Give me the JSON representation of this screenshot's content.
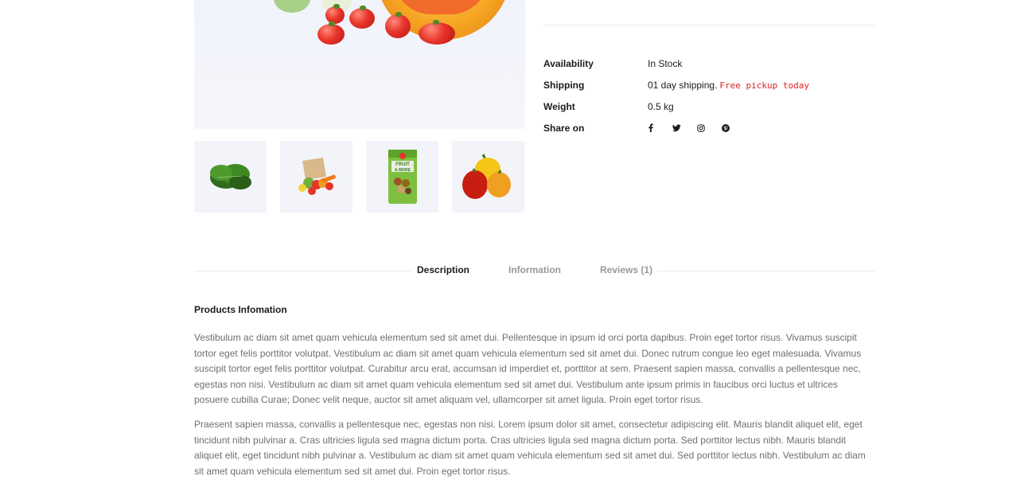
{
  "details": {
    "availability_label": "Availability",
    "availability_value": "In Stock",
    "shipping_label": "Shipping",
    "shipping_value": "01 day shipping.",
    "shipping_note": "Free pickup today",
    "weight_label": "Weight",
    "weight_value": "0.5 kg",
    "share_label": "Share on",
    "share_icons": [
      "facebook-icon",
      "twitter-icon",
      "instagram-icon",
      "pinterest-icon"
    ]
  },
  "thumbnails": [
    "spinach",
    "grocery-bag",
    "fruit-and-more-pack",
    "bell-peppers"
  ],
  "tabs": {
    "description": "Description",
    "information": "Information",
    "reviews": "Reviews (1)"
  },
  "description": {
    "title": "Products Infomation",
    "paragraph1": "Vestibulum ac diam sit amet quam vehicula elementum sed sit amet dui. Pellentesque in ipsum id orci porta dapibus. Proin eget tortor risus. Vivamus suscipit tortor eget felis porttitor volutpat. Vestibulum ac diam sit amet quam vehicula elementum sed sit amet dui. Donec rutrum congue leo eget malesuada. Vivamus suscipit tortor eget felis porttitor volutpat. Curabitur arcu erat, accumsan id imperdiet et, porttitor at sem. Praesent sapien massa, convallis a pellentesque nec, egestas non nisi. Vestibulum ac diam sit amet quam vehicula elementum sed sit amet dui. Vestibulum ante ipsum primis in faucibus orci luctus et ultrices posuere cubilia Curae; Donec velit neque, auctor sit amet aliquam vel, ullamcorper sit amet ligula. Proin eget tortor risus.",
    "paragraph2": "Praesent sapien massa, convallis a pellentesque nec, egestas non nisi. Lorem ipsum dolor sit amet, consectetur adipiscing elit. Mauris blandit aliquet elit, eget tincidunt nibh pulvinar a. Cras ultricies ligula sed magna dictum porta. Cras ultricies ligula sed magna dictum porta. Sed porttitor lectus nibh. Mauris blandit aliquet elit, eget tincidunt nibh pulvinar a. Vestibulum ac diam sit amet quam vehicula elementum sed sit amet dui. Sed porttitor lectus nibh. Vestibulum ac diam sit amet quam vehicula elementum sed sit amet dui. Proin eget tortor risus."
  },
  "colors": {
    "text_dark": "#1c1c1c",
    "text_muted": "#6f6f6f",
    "tab_inactive": "#999999",
    "pickup_red": "#dd2222",
    "image_bg": "#f3f4f9"
  }
}
